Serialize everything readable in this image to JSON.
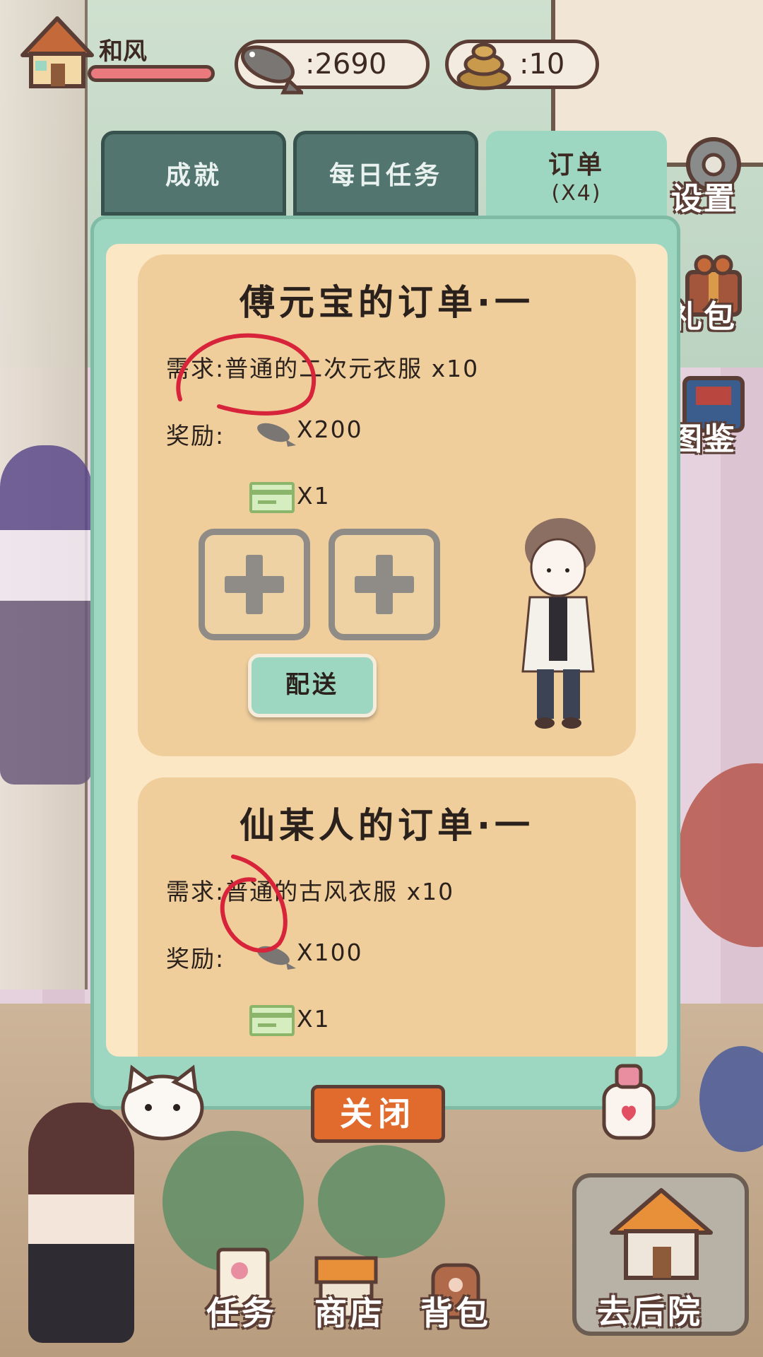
{
  "player": {
    "name": "和风"
  },
  "currency": {
    "fish": ":2690",
    "poop": ":10"
  },
  "tabs": [
    {
      "label": "成就"
    },
    {
      "label": "每日任务"
    },
    {
      "label": "订单",
      "sub": "(X4)"
    }
  ],
  "side_menu": {
    "settings": "设置",
    "gift": "礼包",
    "guide": "图鉴"
  },
  "orders": [
    {
      "title": "傅元宝的订单·一",
      "requirement": "需求:普通的二次元衣服 x10",
      "reward_label": "奖励:",
      "fish_reward": "X200",
      "ticket_reward": "X1",
      "deliver_label": "配送"
    },
    {
      "title": "仙某人的订单·一",
      "requirement": "需求:普通的古风衣服 x10",
      "reward_label": "奖励:",
      "fish_reward": "X100",
      "ticket_reward": "X1"
    }
  ],
  "close_label": "关闭",
  "bottom_nav": {
    "tasks": "任务",
    "shop": "商店",
    "bag": "背包",
    "backyard": "去后院"
  },
  "colors": {
    "panel": "#9dd7c1",
    "card": "#efce9c",
    "close": "#e06b2c",
    "tab_inactive": "#52756f"
  }
}
